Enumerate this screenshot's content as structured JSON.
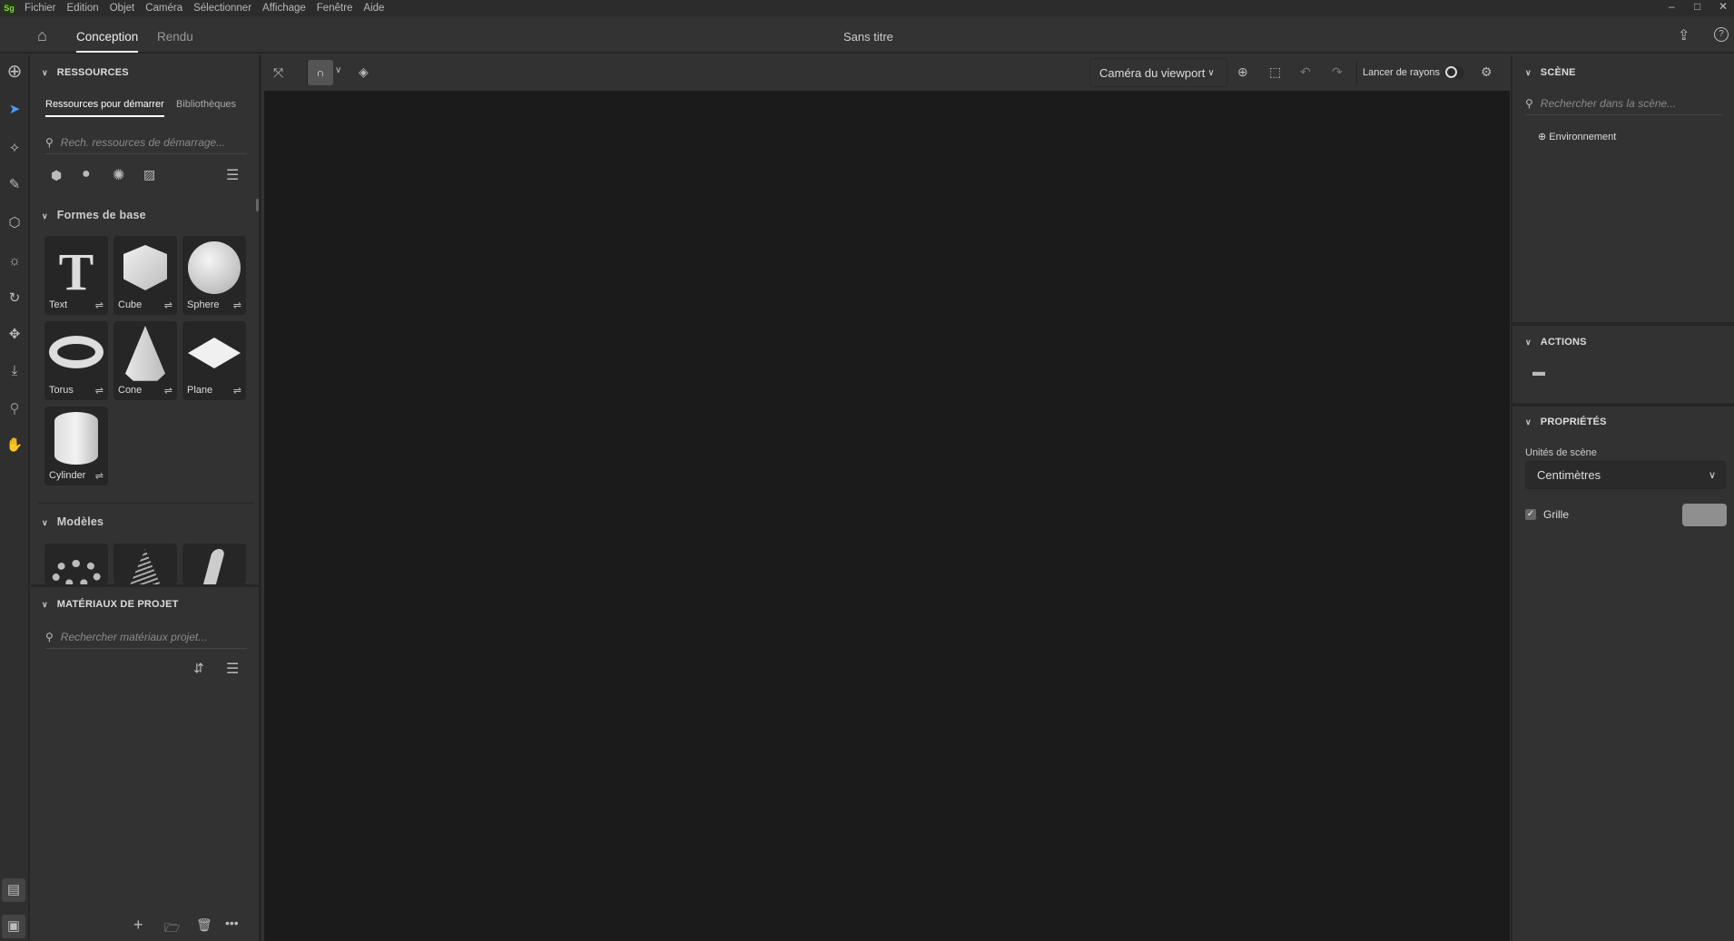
{
  "app": {
    "logo": "Sg",
    "title": "Sans titre",
    "accent": "#4a9cf5"
  },
  "menu": [
    "Fichier",
    "Edition",
    "Objet",
    "Caméra",
    "Sélectionner",
    "Affichage",
    "Fenêtre",
    "Aide"
  ],
  "window_controls": {
    "minimize": "–",
    "maximize": "□",
    "close": "✕"
  },
  "tabs": {
    "active": "Conception",
    "other": "Rendu"
  },
  "resources": {
    "header": "RESSOURCES",
    "tabs": [
      "Ressources pour démarrer",
      "Bibliothèques"
    ],
    "search_placeholder": "Rech. ressources de démarrage...",
    "filter_icons": [
      "cube-icon",
      "material-sphere-icon",
      "light-icon",
      "image-icon"
    ],
    "basic_shapes_header": "Formes de base",
    "basic_shapes": [
      "Text",
      "Cube",
      "Sphere",
      "Torus",
      "Cone",
      "Plane",
      "Cylinder"
    ],
    "models_header": "Modèles"
  },
  "materials": {
    "header": "MATÉRIAUX DE PROJET",
    "search_placeholder": "Rechercher matériaux projet..."
  },
  "toolbar": {
    "camera": "Caméra du viewport",
    "raytrace_label": "Lancer de rayons",
    "raytrace_on": false
  },
  "scene": {
    "header": "SCÈNE",
    "search_placeholder": "Rechercher dans la scène...",
    "items": [
      "Environnement"
    ]
  },
  "actions": {
    "header": "ACTIONS"
  },
  "properties": {
    "header": "PROPRIÉTÉS",
    "units_label": "Unités de scène",
    "units_value": "Centimètres",
    "grid_label": "Grille",
    "grid_checked": true,
    "grid_color": "#8f8f8f"
  }
}
